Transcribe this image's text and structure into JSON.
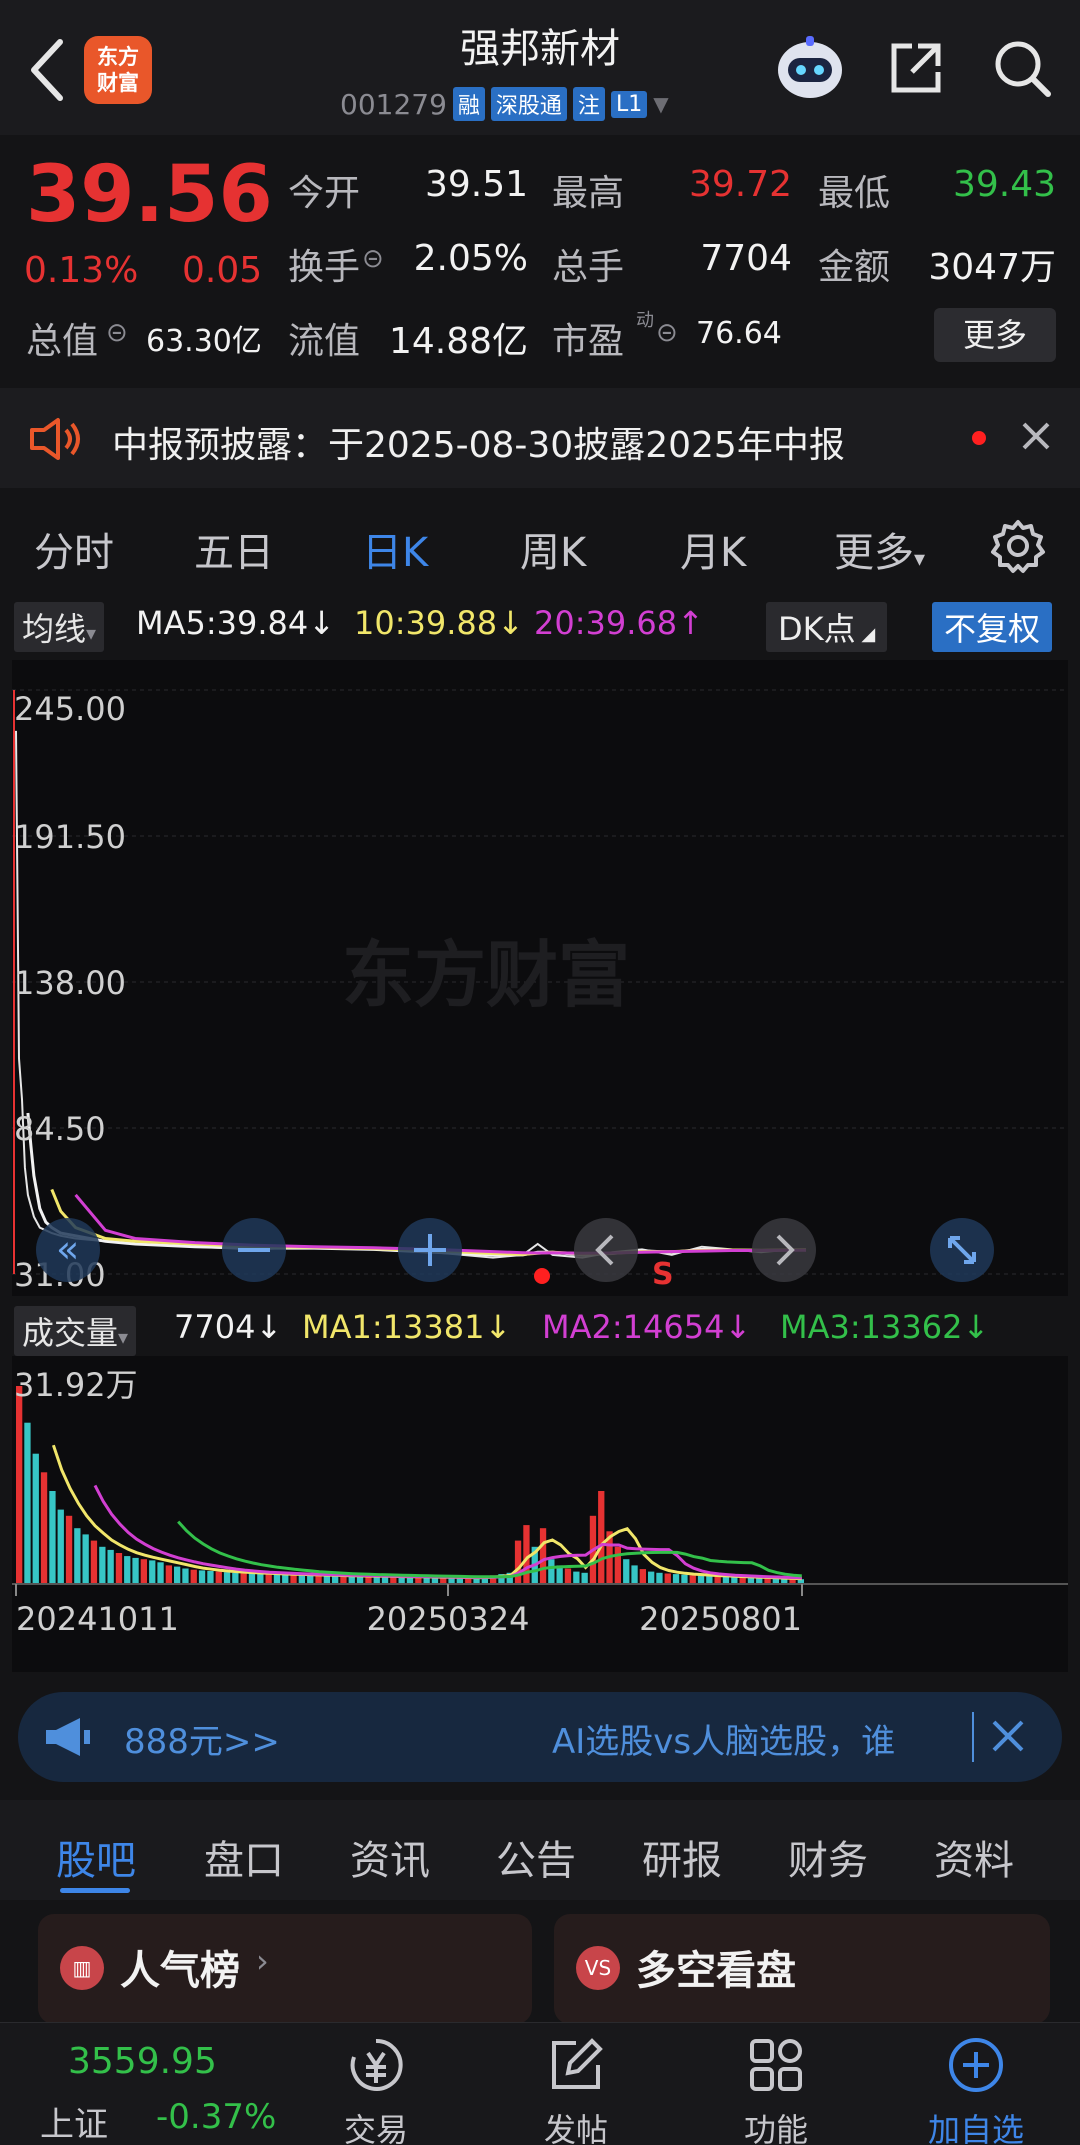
{
  "header": {
    "title": "强邦新材",
    "code": "001279",
    "tags": [
      "融",
      "深股通",
      "注",
      "L1"
    ],
    "logo_text": "东方财富"
  },
  "quote": {
    "price": "39.56",
    "change_pct": "0.13%",
    "change": "0.05",
    "open_label": "今开",
    "open": "39.51",
    "high_label": "最高",
    "high": "39.72",
    "low_label": "最低",
    "low": "39.43",
    "turnover_label": "换手",
    "turnover": "2.05%",
    "volume_label": "总手",
    "volume": "7704",
    "amount_label": "金额",
    "amount": "3047万",
    "mktcap_label": "总值",
    "mktcap": "63.30亿",
    "float_label": "流值",
    "float": "14.88亿",
    "pe_label": "市盈",
    "pe_sup": "动",
    "pe": "76.64",
    "more_label": "更多"
  },
  "notice": {
    "text": "中报预披露：于2025-08-30披露2025年中报"
  },
  "periods": {
    "items": [
      "分时",
      "五日",
      "日K",
      "周K",
      "月K",
      "更多"
    ],
    "active": "日K"
  },
  "ma": {
    "label": "均线",
    "ma5": "MA5:39.84↓",
    "ma10": "10:39.88↓",
    "ma20": "20:39.68↑",
    "dk_label": "DK点",
    "fuquan_label": "不复权"
  },
  "volume_bar": {
    "label": "成交量",
    "value": "7704↓",
    "ma1": "MA1:13381↓",
    "ma2": "MA2:14654↓",
    "ma3": "MA3:13362↓"
  },
  "chart_data": [
    {
      "type": "line",
      "title": "",
      "y_ticks": [
        "245.00",
        "191.50",
        "138.00",
        "84.50",
        "31.00"
      ],
      "ylim": [
        31,
        245
      ],
      "watermark": "东方财富",
      "x": [
        0,
        1,
        2,
        3,
        4,
        5,
        6,
        8,
        10,
        12,
        15,
        20,
        30,
        40,
        60,
        80,
        100,
        120,
        140,
        160,
        170,
        175,
        180,
        190,
        200,
        210,
        220,
        230,
        240,
        250,
        260,
        265
      ],
      "series": [
        {
          "name": "close",
          "color": "#e6e6e6",
          "values": [
            230,
            110,
            95,
            70,
            60,
            56,
            52,
            48,
            47,
            46,
            45,
            44,
            43,
            42,
            41,
            40,
            41,
            40,
            39,
            37,
            38,
            42,
            38,
            37,
            39,
            40,
            38,
            41,
            40,
            39,
            40,
            39.56
          ]
        },
        {
          "name": "MA5",
          "color": "#f2f2f2",
          "values": [
            null,
            null,
            null,
            null,
            90,
            78,
            67,
            55,
            50,
            48,
            46,
            45,
            43,
            42,
            41,
            40.5,
            40.5,
            40,
            39,
            38,
            38,
            39,
            39,
            38,
            38.5,
            39.5,
            39,
            40,
            39.8,
            39.6,
            39.8,
            39.84
          ]
        },
        {
          "name": "MA10",
          "color": "#f1e66a",
          "values": [
            null,
            null,
            null,
            null,
            null,
            null,
            null,
            null,
            null,
            62,
            54,
            48,
            44,
            43,
            42,
            41,
            40.8,
            40.3,
            39.5,
            38.5,
            38.2,
            38.6,
            39,
            38.4,
            38.6,
            39.2,
            39.2,
            39.6,
            39.8,
            39.7,
            39.9,
            39.88
          ]
        },
        {
          "name": "MA20",
          "color": "#d23fd2",
          "values": [
            null,
            null,
            null,
            null,
            null,
            null,
            null,
            null,
            null,
            null,
            null,
            60,
            47,
            44,
            42.5,
            41.5,
            41,
            40.6,
            40,
            39.2,
            38.8,
            38.7,
            38.8,
            38.6,
            38.7,
            39,
            39.2,
            39.4,
            39.6,
            39.6,
            39.7,
            39.68
          ]
        }
      ]
    },
    {
      "type": "bar",
      "title": "",
      "y_max_label": "31.92万",
      "ylim": [
        0,
        319200
      ],
      "x_ticks": [
        "20241011",
        "20250324",
        "20250801"
      ],
      "bars_color_up": "#e63232",
      "bars_color_down": "#37c6c6",
      "values": [
        319200,
        260000,
        210000,
        180000,
        150000,
        120000,
        110000,
        90000,
        80000,
        70000,
        60000,
        55000,
        50000,
        45000,
        42000,
        40000,
        38000,
        35000,
        30000,
        28000,
        25000,
        23000,
        22000,
        21000,
        20000,
        19000,
        18000,
        18000,
        17000,
        17000,
        16000,
        16000,
        15000,
        15000,
        15000,
        14000,
        14000,
        14000,
        13000,
        13000,
        13000,
        12500,
        12500,
        12000,
        12000,
        12000,
        11500,
        11500,
        11000,
        11000,
        11000,
        10500,
        10500,
        10000,
        10000,
        10000,
        12000,
        14000,
        16000,
        18000,
        70000,
        95000,
        60000,
        90000,
        40000,
        30000,
        25000,
        20000,
        18000,
        110000,
        150000,
        85000,
        60000,
        40000,
        30000,
        24000,
        20000,
        18000,
        17000,
        16000,
        15000,
        14000,
        13500,
        13000,
        12500,
        12000,
        11500,
        11000,
        10500,
        10000,
        9500,
        9000,
        8500,
        8000,
        7704
      ],
      "lines": [
        {
          "name": "MA1",
          "color": "#f1e66a"
        },
        {
          "name": "MA2",
          "color": "#d23fd2"
        },
        {
          "name": "MA3",
          "color": "#33c04a"
        }
      ]
    }
  ],
  "promo": {
    "left_text": "888元>>",
    "right_text": "AI选股vs人脑选股，谁"
  },
  "subtabs": {
    "items": [
      "股吧",
      "盘口",
      "资讯",
      "公告",
      "研报",
      "财务",
      "资料"
    ],
    "active": "股吧"
  },
  "cards": {
    "left": "人气榜",
    "right": "多空看盘",
    "right_icon": "VS"
  },
  "navbar": {
    "index_value": "3559.95",
    "index_name": "上证",
    "index_change": "-0.37%",
    "items": [
      "交易",
      "发帖",
      "功能",
      "加自选"
    ]
  },
  "colors": {
    "accent": "#3e86e8",
    "up": "#e63232",
    "down": "#33c04a"
  }
}
